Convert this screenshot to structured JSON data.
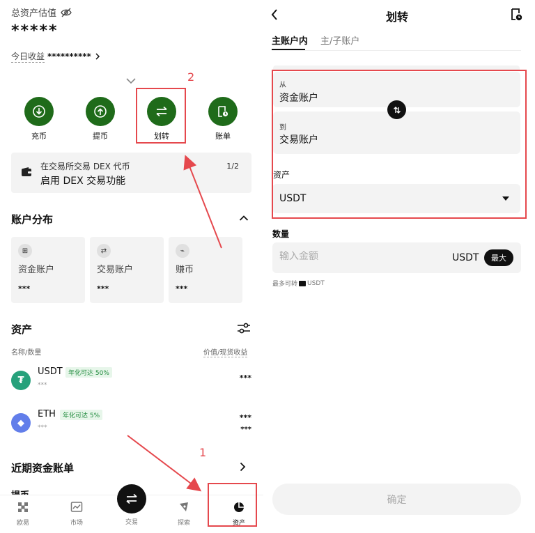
{
  "colors": {
    "brand_green": "#1f6b1a",
    "annotation_red": "#e5484d",
    "card_bg": "#f3f3f3",
    "apy_green": "#1f8a3c"
  },
  "left": {
    "header": {
      "total_label": "总资产估值",
      "hide_icon": "eye-off-icon",
      "balance": "*****",
      "today_label": "今日收益",
      "today_value": "**********"
    },
    "actions": [
      {
        "label": "充币",
        "icon": "deposit-icon"
      },
      {
        "label": "提币",
        "icon": "withdraw-icon"
      },
      {
        "label": "划转",
        "icon": "transfer-icon"
      },
      {
        "label": "账单",
        "icon": "bill-icon"
      }
    ],
    "annotations": {
      "step2": "2",
      "step1": "1"
    },
    "banner": {
      "line1": "在交易所交易 DEX 代币",
      "line2": "启用 DEX 交易功能",
      "page": "1/2"
    },
    "distribution": {
      "title": "账户分布",
      "cards": [
        {
          "name": "资金账户",
          "value": "***",
          "icon_glyph": "⊞"
        },
        {
          "name": "交易账户",
          "value": "***",
          "icon_glyph": "⇄"
        },
        {
          "name": "赚币",
          "value": "***",
          "icon_glyph": "⌁"
        }
      ]
    },
    "assets": {
      "title": "资产",
      "col_left": "名称/数量",
      "col_right": "价值/现货收益",
      "rows": [
        {
          "symbol": "USDT",
          "apy": "年化可达 50%",
          "amount": "***",
          "value": "***",
          "pnl": "",
          "logo_color": "#26a17b",
          "logo_glyph": "₮"
        },
        {
          "symbol": "ETH",
          "apy": "年化可达 5%",
          "amount": "***",
          "value": "***",
          "pnl": "***",
          "logo_color": "#627eea",
          "logo_glyph": "◆"
        }
      ]
    },
    "recent": {
      "title": "近期资金账单",
      "peek": "提币"
    },
    "nav": [
      {
        "label": "欧易",
        "icon": "home-icon"
      },
      {
        "label": "市场",
        "icon": "market-icon"
      },
      {
        "label": "交易",
        "icon": "trade-icon"
      },
      {
        "label": "探索",
        "icon": "explore-icon"
      },
      {
        "label": "资产",
        "icon": "assets-icon"
      }
    ]
  },
  "right": {
    "title": "划转",
    "tabs": [
      "主账户内",
      "主/子账户"
    ],
    "from_label": "从",
    "from_value": "资金账户",
    "to_label": "到",
    "to_value": "交易账户",
    "asset_label": "资产",
    "asset_value": "USDT",
    "amount_label": "数量",
    "amount_placeholder": "输入金额",
    "amount_unit": "USDT",
    "max_label": "最大",
    "max_avail_label": "最多可转",
    "max_avail_unit": "USDT",
    "confirm": "确定"
  }
}
